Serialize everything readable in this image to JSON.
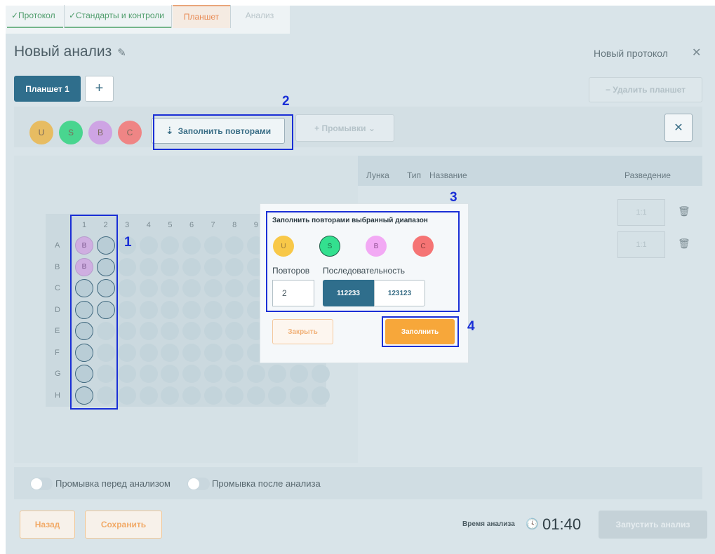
{
  "tabs": [
    {
      "label": "✓Протокол",
      "state": "done"
    },
    {
      "label": "✓Стандарты и контроли",
      "state": "done"
    },
    {
      "label": "Планшет",
      "state": "active"
    },
    {
      "label": "Анализ",
      "state": "disabled"
    }
  ],
  "header": {
    "title": "Новый анализ",
    "edit_icon": "✎",
    "protocol_label": "Новый протокол",
    "close_icon": "✕"
  },
  "plates": {
    "active_plate": "Планшет 1",
    "add_label": "+",
    "delete_label": "− Удалить планшет"
  },
  "toolbar": {
    "chips": [
      {
        "letter": "U",
        "color": "#e7bc62"
      },
      {
        "letter": "S",
        "color": "#49d58f"
      },
      {
        "letter": "B",
        "color": "#cea4e4"
      },
      {
        "letter": "C",
        "color": "#ef8585"
      }
    ],
    "fill_repeats_icon": "⇣",
    "fill_repeats_label": "Заполнить повторами",
    "washes_label": "+ Промывки ⌄",
    "close_icon": "✕"
  },
  "table": {
    "headers": [
      "Лунка",
      "Тип",
      "Название",
      "Разведение"
    ],
    "dilutions": [
      "1:1",
      "1:1"
    ],
    "trash_icon": "🗑"
  },
  "plate_grid": {
    "columns": [
      "1",
      "2",
      "3",
      "4",
      "5",
      "6",
      "7",
      "8",
      "9"
    ],
    "rows": [
      "A",
      "B",
      "C",
      "D",
      "E",
      "F",
      "G",
      "H"
    ],
    "filled_wells": [
      {
        "row": "A",
        "col": "1",
        "label": "B"
      },
      {
        "row": "B",
        "col": "1",
        "label": "B"
      }
    ]
  },
  "popup": {
    "title": "Заполнить повторами выбранный диапазон",
    "chips": [
      {
        "letter": "U",
        "color": "#f8c848",
        "text_color": "#9a7a3a"
      },
      {
        "letter": "S",
        "color": "#33e08f",
        "text_color": "#1d6b45",
        "border": "#1f5f48"
      },
      {
        "letter": "B",
        "color": "#f2a9f4",
        "text_color": "#8c4e8f"
      },
      {
        "letter": "C",
        "color": "#f57474",
        "text_color": "#8a3b3b"
      }
    ],
    "repeats_label": "Повторов",
    "repeats_value": "2",
    "sequence_label": "Последовательность",
    "sequence_options": [
      "112233",
      "123123"
    ],
    "sequence_selected": "112233",
    "close_label": "Закрыть",
    "fill_label": "Заполнить"
  },
  "annotations": [
    "1",
    "2",
    "3",
    "4"
  ],
  "washes": {
    "before_label": "Промывка перед анализом",
    "after_label": "Промывка после анализа"
  },
  "footer": {
    "back_label": "Назад",
    "save_label": "Сохранить",
    "time_label": "Время анализа",
    "clock_icon": "🕓",
    "time_value": "01:40",
    "run_label": "Запустить анализ"
  }
}
